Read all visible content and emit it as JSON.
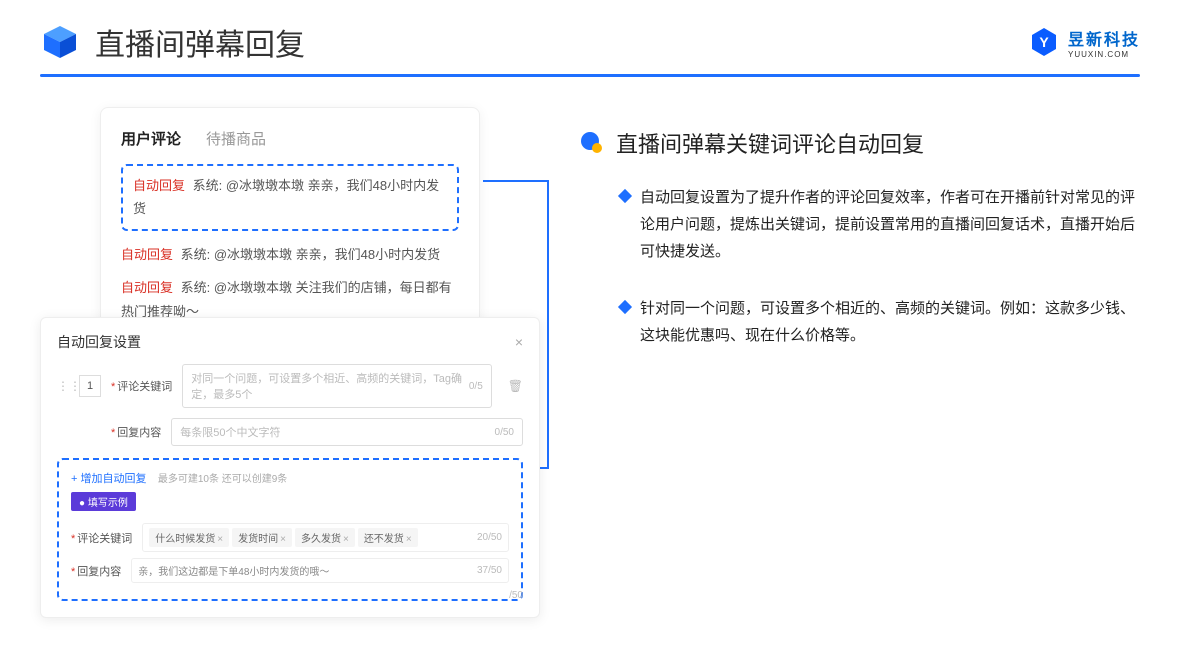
{
  "header": {
    "title": "直播间弹幕回复",
    "brand_name": "昱新科技",
    "brand_sub": "YUUXIN.COM"
  },
  "card1": {
    "tab_active": "用户评论",
    "tab_inactive": "待播商品",
    "highlight_badge": "自动回复",
    "highlight_text": "系统: @冰墩墩本墩 亲亲，我们48小时内发货",
    "c2_badge": "自动回复",
    "c2_text": "系统: @冰墩墩本墩 亲亲，我们48小时内发货",
    "c3_badge": "自动回复",
    "c3_text": "系统: @冰墩墩本墩 关注我们的店铺，每日都有热门推荐呦～"
  },
  "card2": {
    "title": "自动回复设置",
    "num": "1",
    "label_keyword": "评论关键词",
    "placeholder_keyword": "对同一个问题，可设置多个相近、高频的关键词，Tag确定，最多5个",
    "count_keyword": "0/5",
    "label_content": "回复内容",
    "placeholder_content": "每条限50个中文字符",
    "count_content": "0/50",
    "add_link": "+ 增加自动回复",
    "add_sub": "最多可建10条 还可以创建9条",
    "tag_example": "● 填写示例",
    "ex_label_keyword": "评论关键词",
    "chips": [
      "什么时候发货",
      "发货时间",
      "多久发货",
      "还不发货"
    ],
    "ex_kw_count": "20/50",
    "ex_label_content": "回复内容",
    "ex_content_text": "亲，我们这边都是下单48小时内发货的哦～",
    "ex_content_count": "37/50",
    "outer_count": "/50"
  },
  "right": {
    "title": "直播间弹幕关键词评论自动回复",
    "b1": "自动回复设置为了提升作者的评论回复效率，作者可在开播前针对常见的评论用户问题，提炼出关键词，提前设置常用的直播间回复话术，直播开始后可快捷发送。",
    "b2": "针对同一个问题，可设置多个相近的、高频的关键词。例如：这款多少钱、这块能优惠吗、现在什么价格等。"
  }
}
